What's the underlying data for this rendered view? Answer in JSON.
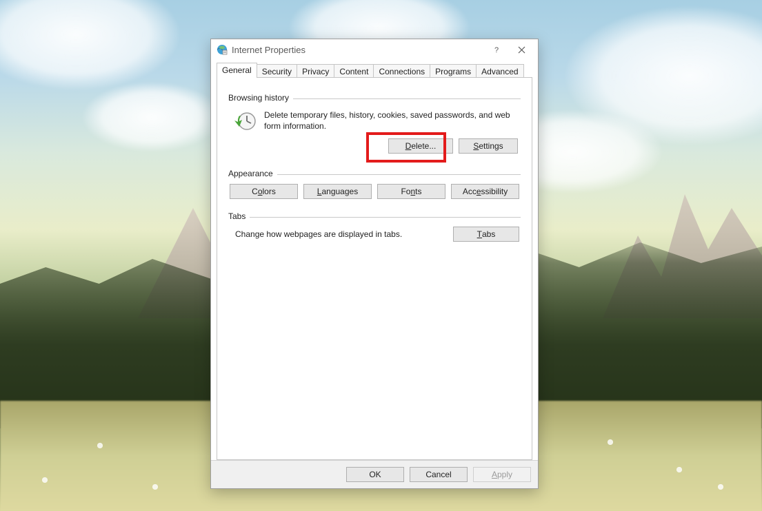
{
  "window": {
    "title": "Internet Properties"
  },
  "tabs": [
    {
      "label": "General"
    },
    {
      "label": "Security"
    },
    {
      "label": "Privacy"
    },
    {
      "label": "Content"
    },
    {
      "label": "Connections"
    },
    {
      "label": "Programs"
    },
    {
      "label": "Advanced"
    }
  ],
  "browsing": {
    "header": "Browsing history",
    "description": "Delete temporary files, history, cookies, saved passwords, and web form information.",
    "delete_btn_pre": "",
    "delete_btn_u": "D",
    "delete_btn_post": "elete...",
    "settings_btn_pre": "",
    "settings_btn_u": "S",
    "settings_btn_post": "ettings"
  },
  "appearance": {
    "header": "Appearance",
    "colors_pre": "C",
    "colors_u": "o",
    "colors_post": "lors",
    "languages_pre": "",
    "languages_u": "L",
    "languages_post": "anguages",
    "fonts_pre": "Fo",
    "fonts_u": "n",
    "fonts_post": "ts",
    "access_pre": "Acc",
    "access_u": "e",
    "access_post": "ssibility"
  },
  "tabs_section": {
    "header": "Tabs",
    "text": "Change how webpages are displayed in tabs.",
    "btn_pre": "",
    "btn_u": "T",
    "btn_post": "abs"
  },
  "footer": {
    "ok": "OK",
    "cancel": "Cancel",
    "apply_pre": "",
    "apply_u": "A",
    "apply_post": "pply"
  }
}
